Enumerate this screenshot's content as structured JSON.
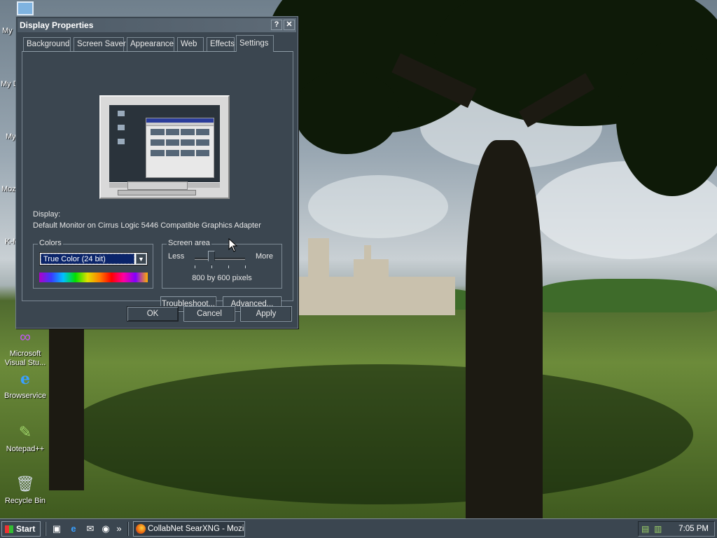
{
  "desktop": {
    "edge_labels": [
      "My",
      "My D",
      "My",
      "Moz",
      "K-M"
    ],
    "icons": [
      {
        "label1": "Microsoft",
        "label2": "Visual Stu...",
        "icon": "visual-studio-icon"
      },
      {
        "label1": "Browservice",
        "label2": "",
        "icon": "internet-explorer-icon"
      },
      {
        "label1": "Notepad++",
        "label2": "",
        "icon": "notepad-plus-plus-icon"
      },
      {
        "label1": "Recycle Bin",
        "label2": "",
        "icon": "recycle-bin-icon"
      }
    ]
  },
  "dialog": {
    "title": "Display Properties",
    "help_glyph": "?",
    "close_glyph": "✕",
    "tabs": [
      "Background",
      "Screen Saver",
      "Appearance",
      "Web",
      "Effects",
      "Settings"
    ],
    "active_tab": "Settings",
    "display_label": "Display:",
    "display_value": "Default Monitor on Cirrus Logic 5446 Compatible Graphics Adapter",
    "colors": {
      "title": "Colors",
      "selected": "True Color (24 bit)",
      "arrow": "▼"
    },
    "screen_area": {
      "title": "Screen area",
      "less": "Less",
      "more": "More",
      "value": "800 by 600 pixels",
      "slider_fraction": 0.33
    },
    "buttons": {
      "troubleshoot": "Troubleshoot...",
      "advanced": "Advanced...",
      "ok": "OK",
      "cancel": "Cancel",
      "apply": "Apply"
    }
  },
  "taskbar": {
    "start": "Start",
    "overflow": "»",
    "task_item": "CollabNet SearXNG - Mozil...",
    "clock": "7:05 PM"
  }
}
